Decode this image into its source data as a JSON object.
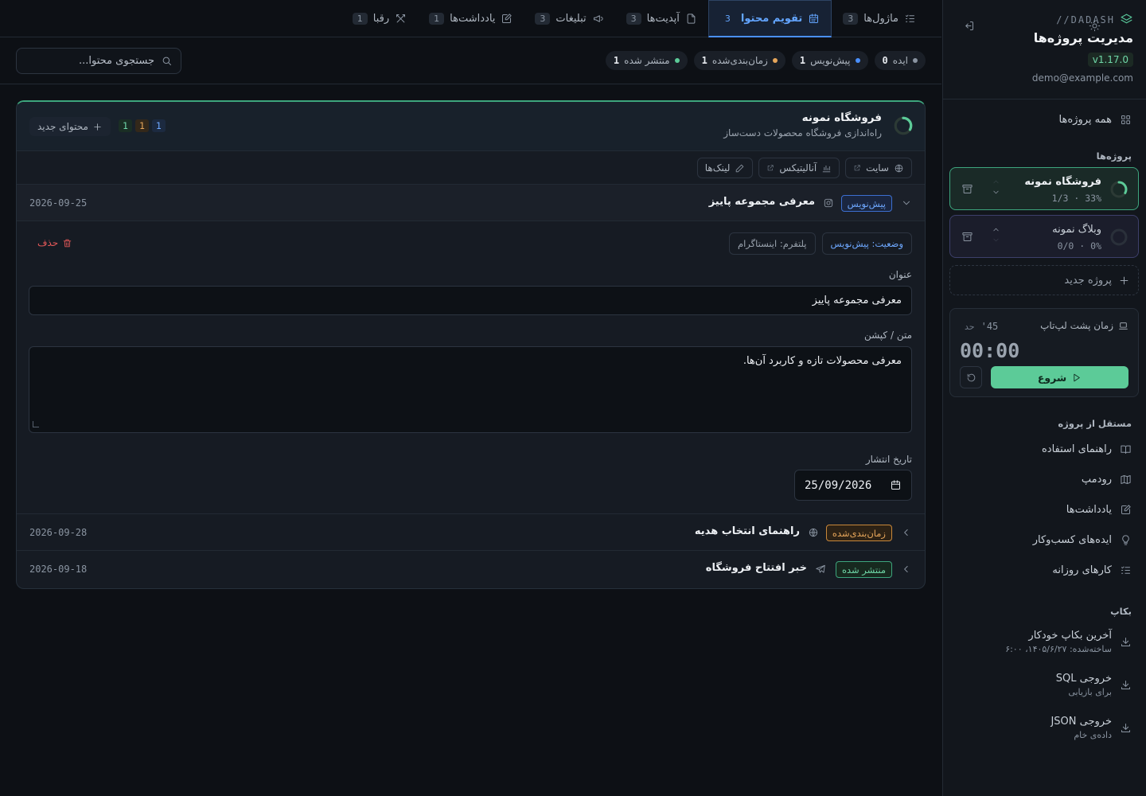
{
  "brand": {
    "name": "//DADASH",
    "title": "مدیریت پروژه‌ها",
    "version": "v1.17.0",
    "user_email": "demo@example.com"
  },
  "sidebar": {
    "all_projects": "همه پروژه‌ها",
    "projects_label": "پروژه‌ها",
    "projects": [
      {
        "name": "فروشگاه نمونه",
        "percent": "33%",
        "ratio": "1/3",
        "progress": 0.33
      },
      {
        "name": "وبلاگ نمونه",
        "percent": "0%",
        "ratio": "0/0",
        "progress": 0
      }
    ],
    "new_project": "پروژه جدید",
    "timer": {
      "label": "زمان پشت لپ‌تاپ",
      "limit_label": "حد",
      "limit_value": "45'",
      "clock": "00:00",
      "start": "شروع"
    },
    "independent_label": "مستقل از پروژه",
    "independent_links": [
      "راهنمای استفاده",
      "رودمپ",
      "یادداشت‌ها",
      "ایده‌های کسب‌وکار",
      "کارهای روزانه"
    ],
    "backup_label": "بکاپ",
    "backups": [
      {
        "title": "آخرین بکاپ خودکار",
        "sub": "ساخته‌شده: ۱۴۰۵/۶/۲۷، ۶:۰۰"
      },
      {
        "title": "خروجی SQL",
        "sub": "برای بازیابی"
      },
      {
        "title": "خروجی JSON",
        "sub": "داده‌ی خام"
      }
    ]
  },
  "tabs": [
    {
      "label": "ماژول‌ها",
      "count": "3",
      "icon": "list-check-icon"
    },
    {
      "label": "تقویم محتوا",
      "count": "3",
      "icon": "calendar-icon",
      "active": true
    },
    {
      "label": "آپدیت‌ها",
      "count": "3",
      "icon": "file-icon"
    },
    {
      "label": "تبلیغات",
      "count": "3",
      "icon": "megaphone-icon"
    },
    {
      "label": "یادداشت‌ها",
      "count": "1",
      "icon": "note-edit-icon"
    },
    {
      "label": "رقبا",
      "count": "1",
      "icon": "swords-icon"
    }
  ],
  "status_filters": [
    {
      "label": "ایده",
      "count": "0",
      "color": "#8a94a1"
    },
    {
      "label": "پیش‌نویس",
      "count": "1",
      "color": "#4a90ff"
    },
    {
      "label": "زمان‌بندی‌شده",
      "count": "1",
      "color": "#e5a55a"
    },
    {
      "label": "منتشر شده",
      "count": "1",
      "color": "#5ccb98"
    }
  ],
  "search": {
    "placeholder": "جستجوی محتوا..."
  },
  "project_panel": {
    "title": "فروشگاه نمونه",
    "subtitle": "راه‌اندازی فروشگاه محصولات دست‌ساز",
    "progress": 0.33,
    "counts": [
      "1",
      "1",
      "1"
    ],
    "new_content": "محتوای جدید",
    "links": [
      "سایت",
      "آنالیتیکس",
      "لینک‌ها"
    ]
  },
  "content_items": [
    {
      "title": "معرفی مجموعه پاییز",
      "badge": "پیش‌نویس",
      "date": "2026-09-25",
      "platform_icon": "instagram-icon"
    },
    {
      "title": "راهنمای انتخاب هدیه",
      "badge": "زمان‌بندی‌شده",
      "date": "2026-09-28",
      "platform_icon": "globe-icon"
    },
    {
      "title": "خبر افتتاح فروشگاه",
      "badge": "منتشر شده",
      "date": "2026-09-18",
      "platform_icon": "telegram-icon"
    }
  ],
  "editor": {
    "status_chip": "وضعیت: پیش‌نویس",
    "platform_chip": "پلتفرم: اینستاگرام",
    "delete": "حذف",
    "title_label": "عنوان",
    "title_value": "معرفی مجموعه پاییز",
    "caption_label": "متن / کپشن",
    "caption_value": "معرفی محصولات تازه و کاربرد آن‌ها.",
    "date_label": "تاریخ انتشار",
    "date_value": "25/09/2026"
  },
  "colors": {
    "accent": "#5ccb98",
    "draft": "#4a90ff",
    "scheduled": "#e5a55a",
    "published": "#5ccb98",
    "danger": "#e45858"
  }
}
